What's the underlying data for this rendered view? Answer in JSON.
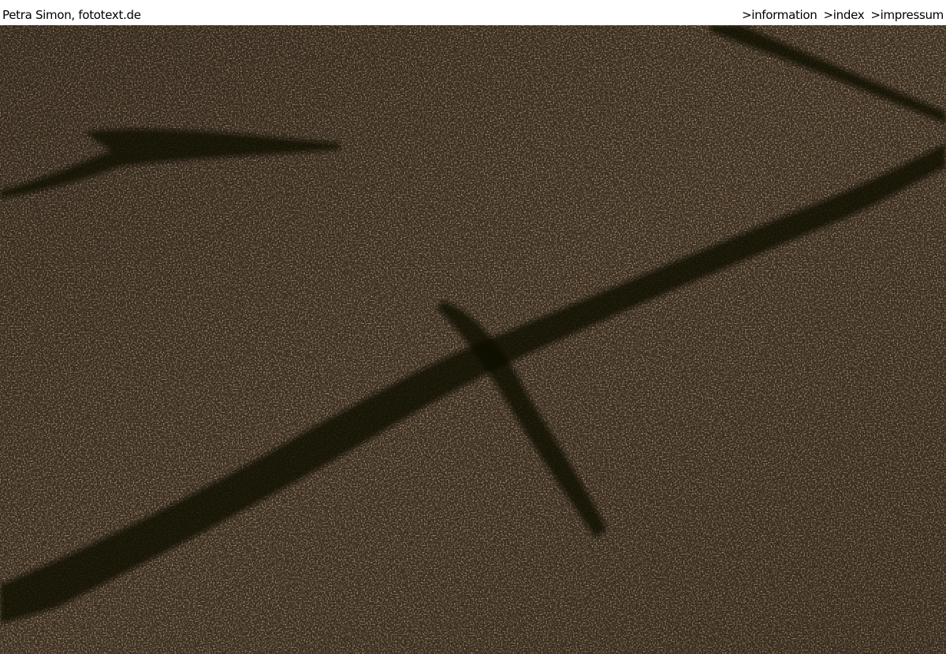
{
  "header": {
    "site_title": "Petra Simon, fototext.de",
    "nav": [
      {
        "label": ">information"
      },
      {
        "label": ">index"
      },
      {
        "label": ">impressum"
      }
    ]
  },
  "photo": {
    "subject": "asphalt",
    "colors": {
      "base": "#3a2e20",
      "highlight": "#c8a060",
      "shadow": "#0a0704"
    }
  }
}
